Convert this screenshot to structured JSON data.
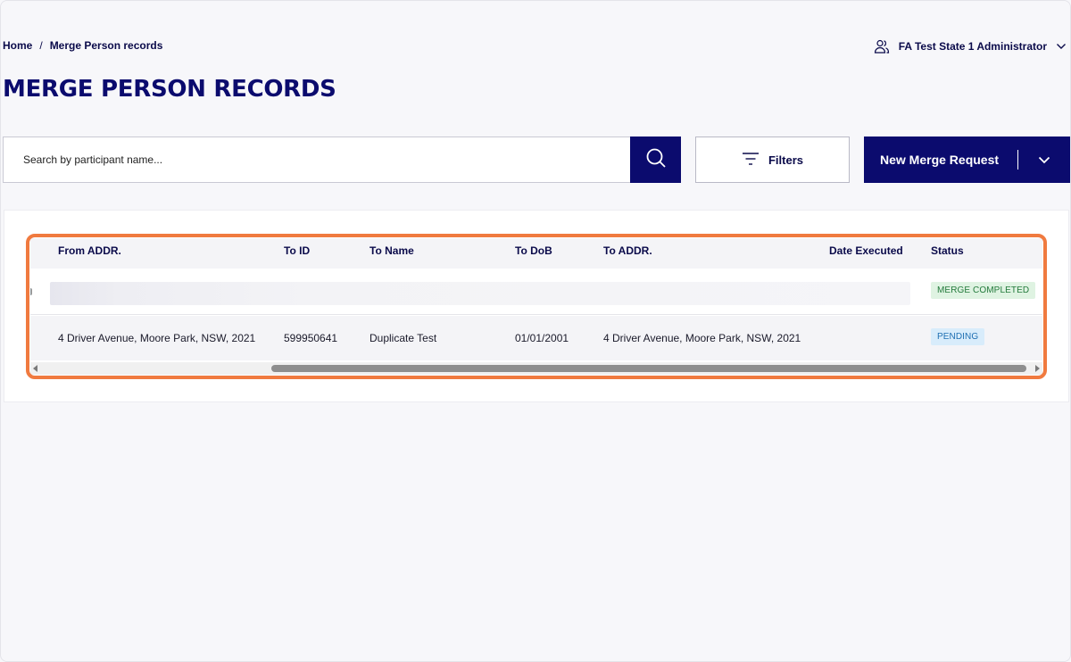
{
  "breadcrumb": {
    "home": "Home",
    "separator": "/",
    "current": "Merge Person records"
  },
  "user": {
    "name": "FA Test State 1 Administrator",
    "icon": "users-icon"
  },
  "page": {
    "title": "MERGE PERSON RECORDS"
  },
  "search": {
    "placeholder": "Search by participant name...",
    "value": ""
  },
  "toolbar": {
    "filters_label": "Filters",
    "new_merge_label": "New Merge Request"
  },
  "table": {
    "columns": [
      "From ADDR.",
      "To ID",
      "To Name",
      "To DoB",
      "To ADDR.",
      "Date Executed",
      "Status"
    ],
    "rows": [
      {
        "from_addr": "",
        "to_id": "",
        "to_name": "",
        "to_dob": "",
        "to_addr": "",
        "date_executed": "",
        "status": "MERGE COMPLETED"
      },
      {
        "from_addr": "4 Driver Avenue, Moore Park, NSW, 2021",
        "to_id": "599950641",
        "to_name": "Duplicate Test",
        "to_dob": "01/01/2001",
        "to_addr": "4 Driver Avenue, Moore Park, NSW, 2021",
        "date_executed": "",
        "status": "PENDING"
      }
    ]
  },
  "colors": {
    "brand": "#0b0b6e",
    "highlight": "#f07a3f",
    "status_completed_bg": "#dff3e2",
    "status_completed_text": "#237a3b",
    "status_pending_bg": "#d8ecfb",
    "status_pending_text": "#1f6fb2"
  }
}
